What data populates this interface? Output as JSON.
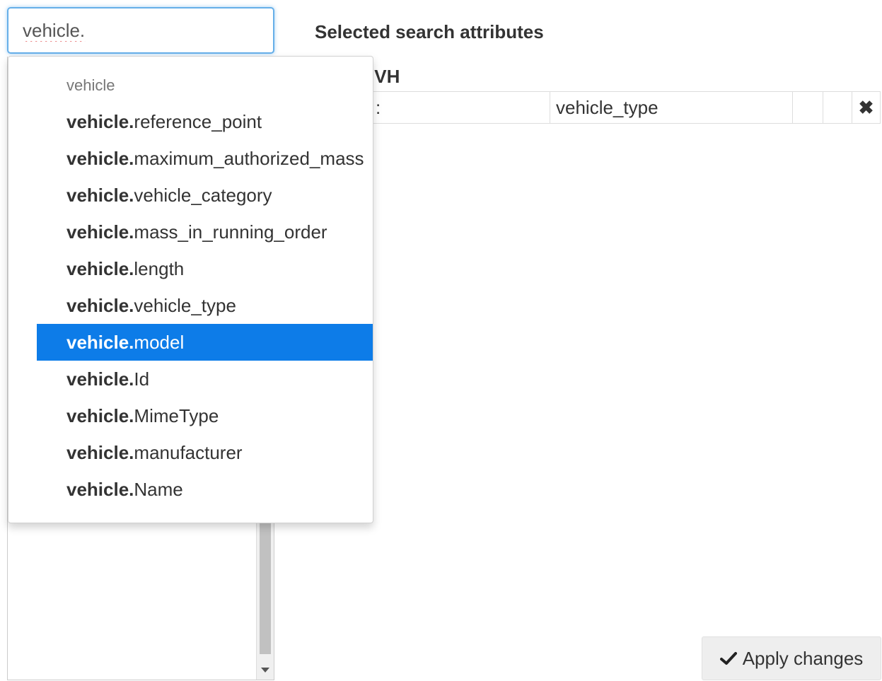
{
  "search": {
    "value": "vehicle."
  },
  "heading": "Selected search attributes",
  "group_label": "IVH",
  "table": {
    "row": {
      "partial_cell": ":",
      "attribute": "vehicle_type",
      "extra1": "",
      "extra2": "",
      "remove_glyph": "✖"
    }
  },
  "apply_button": {
    "label": "Apply changes",
    "icon": "check-icon"
  },
  "dropdown": {
    "header": "vehicle",
    "items": [
      {
        "prefix": "vehicle.",
        "suffix": "reference_point",
        "active": false
      },
      {
        "prefix": "vehicle.",
        "suffix": "maximum_authorized_mass",
        "active": false
      },
      {
        "prefix": "vehicle.",
        "suffix": "vehicle_category",
        "active": false
      },
      {
        "prefix": "vehicle.",
        "suffix": "mass_in_running_order",
        "active": false
      },
      {
        "prefix": "vehicle.",
        "suffix": "length",
        "active": false
      },
      {
        "prefix": "vehicle.",
        "suffix": "vehicle_type",
        "active": false
      },
      {
        "prefix": "vehicle.",
        "suffix": "model",
        "active": true
      },
      {
        "prefix": "vehicle.",
        "suffix": "Id",
        "active": false
      },
      {
        "prefix": "vehicle.",
        "suffix": "MimeType",
        "active": false
      },
      {
        "prefix": "vehicle.",
        "suffix": "manufacturer",
        "active": false
      },
      {
        "prefix": "vehicle.",
        "suffix": "Name",
        "active": false
      }
    ]
  },
  "colors": {
    "active_bg": "#0d7ce8",
    "focus_border": "#66afe9",
    "button_bg": "#eeeeee"
  }
}
